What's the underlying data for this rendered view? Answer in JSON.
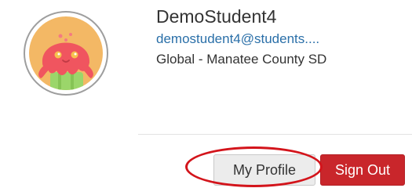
{
  "user": {
    "name": "DemoStudent4",
    "email": "demostudent4@students....",
    "organization": "Global - Manatee County SD",
    "avatar_icon": "octopus-mascot-avatar"
  },
  "actions": {
    "profile_label": "My Profile",
    "signout_label": "Sign Out"
  },
  "colors": {
    "signout_bg": "#c9262b",
    "email_link": "#2a6fa8",
    "annotation_ring": "#d3141b",
    "avatar_bg": "#f3b865",
    "avatar_character": "#f0555f"
  }
}
